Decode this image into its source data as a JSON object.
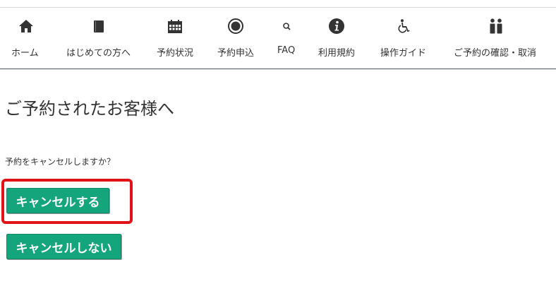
{
  "nav": {
    "items": [
      {
        "label": "ホーム",
        "icon": "home-icon"
      },
      {
        "label": "はじめての方へ",
        "icon": "book-icon"
      },
      {
        "label": "予約状況",
        "icon": "calendar-icon"
      },
      {
        "label": "予約申込",
        "icon": "radio-icon"
      },
      {
        "label": "FAQ",
        "icon": "search-icon"
      },
      {
        "label": "利用規約",
        "icon": "info-icon"
      },
      {
        "label": "操作ガイド",
        "icon": "wheelchair-icon"
      },
      {
        "label": "ご予約の確認・取消",
        "icon": "people-icon"
      }
    ]
  },
  "main": {
    "title": "ご予約されたお客様へ",
    "question": "予約をキャンセルしますか？",
    "cancel_button": "キャンセルする",
    "keep_button": "キャンセルしない"
  },
  "colors": {
    "button": "#14a57d",
    "highlight": "#e21318",
    "nav_border": "#4a5466"
  }
}
